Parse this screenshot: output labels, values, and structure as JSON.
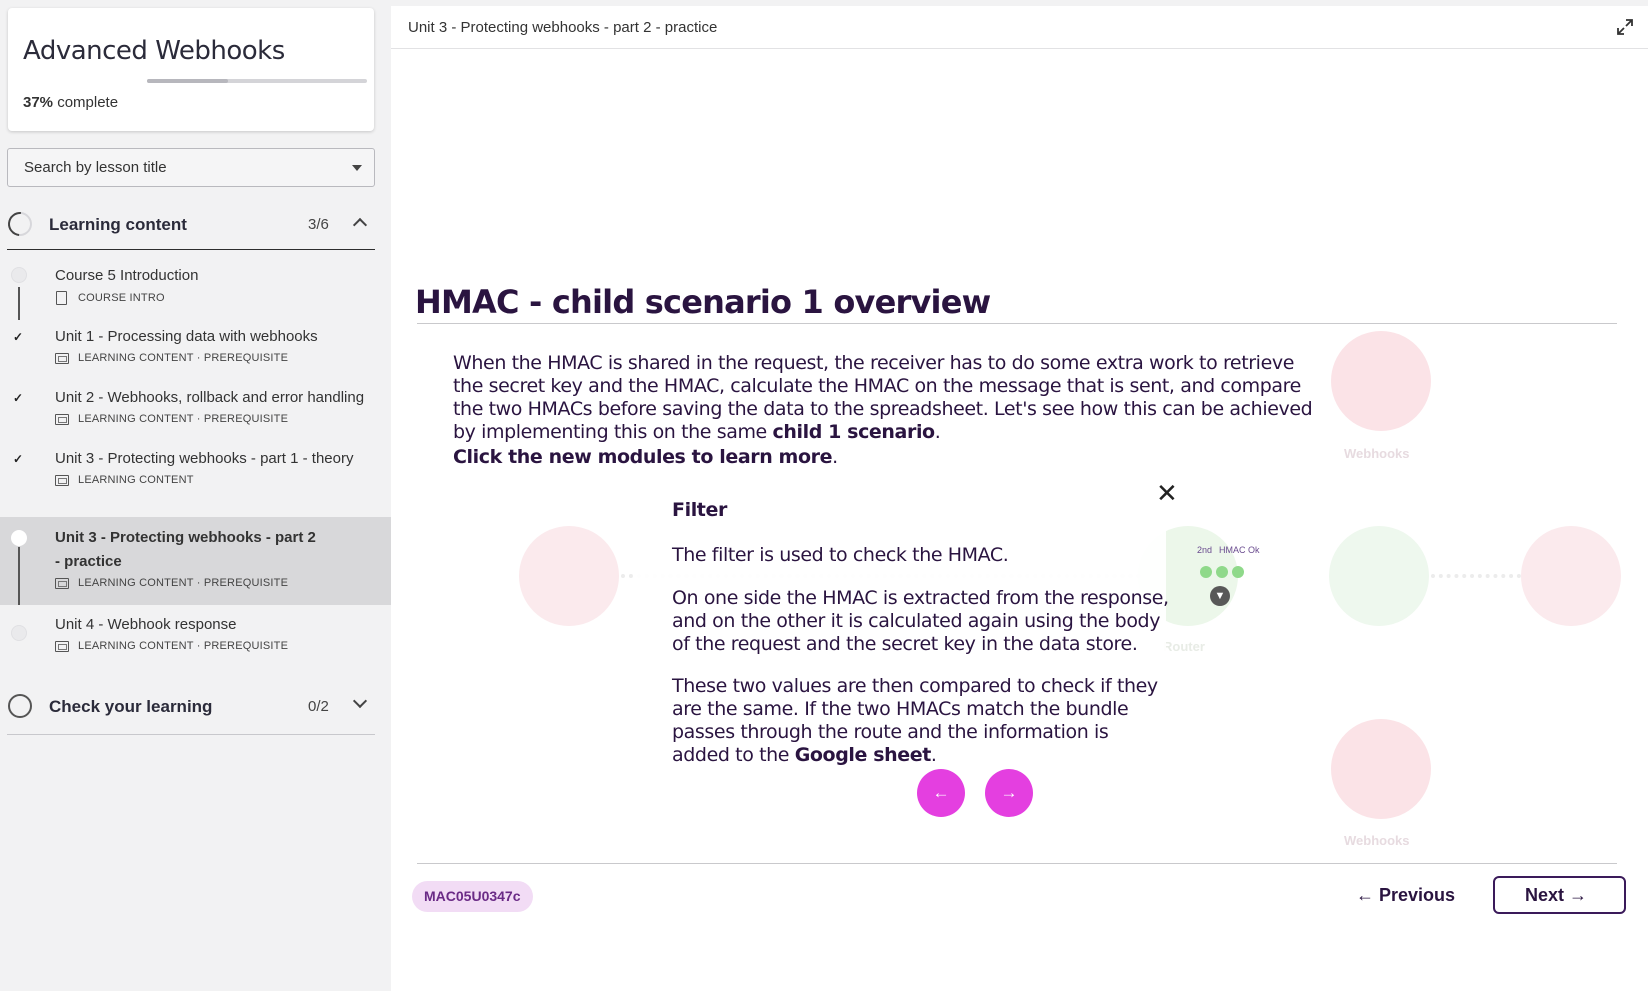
{
  "course": {
    "title": "Advanced Webhooks",
    "percent": "37%",
    "complete_word": "complete",
    "progress_fraction": 0.37
  },
  "search": {
    "label": "Search by lesson title"
  },
  "sections": {
    "learning": {
      "title": "Learning content",
      "count": "3/6"
    },
    "check": {
      "title": "Check your learning",
      "count": "0/2"
    }
  },
  "lessons": [
    {
      "title": "Course 5 Introduction",
      "meta": "COURSE INTRO",
      "done": false
    },
    {
      "title": "Unit 1 - Processing data with webhooks",
      "meta": "LEARNING CONTENT · PREREQUISITE",
      "done": true
    },
    {
      "title": "Unit 2 - Webhooks, rollback and error handling",
      "meta": "LEARNING CONTENT · PREREQUISITE",
      "done": true
    },
    {
      "title": "Unit 3 - Protecting webhooks - part 1 - theory",
      "meta": "LEARNING CONTENT",
      "done": true
    },
    {
      "title": "Unit 3 - Protecting webhooks - part 2 - practice",
      "meta": "LEARNING CONTENT · PREREQUISITE",
      "done": false,
      "active": true
    },
    {
      "title": "Unit 4 - Webhook response",
      "meta": "LEARNING CONTENT · PREREQUISITE",
      "done": false
    }
  ],
  "main": {
    "topbar_title": "Unit 3 - Protecting webhooks - part 2 - practice",
    "heading": "HMAC - child scenario 1 overview",
    "intro_text": "When the HMAC is shared in the request, the receiver has to do some extra work to retrieve the secret key and the HMAC, calculate the HMAC on the message that is sent, and compare the two HMACs before saving the data to the spreadsheet. Let's see how this can be achieved by implementing this on the same ",
    "intro_bold": "child 1 scenario",
    "intro_end": ".",
    "click_bold": "Click the new modules to learn more",
    "click_end": "."
  },
  "popover": {
    "title": "Filter",
    "p1": "The filter is used to check the HMAC.",
    "p2": "On one side the HMAC is extracted from the response, and on the other it is calculated again using the body of the request and the secret key in the data store.",
    "p3": "These two values are then compared to check if they are the same. If the two HMACs match the bundle passes through the route and the information is added to the ",
    "p3_bold": "Google sheet",
    "p3_end": ".",
    "close_glyph": "✕",
    "prev_glyph": "←",
    "next_glyph": "→"
  },
  "scenario_labels": {
    "webhooks": "Webhooks",
    "router": "Router"
  },
  "minimap": {
    "label_a": "2nd",
    "label_b": "HMAC Ok"
  },
  "footer": {
    "code": "MAC05U0347c",
    "previous": "← Previous",
    "next": "Next →"
  },
  "colors": {
    "accent_pink": "#e43fe0",
    "heading_purple": "#2a1440",
    "badge_bg": "#f2dcf5"
  }
}
